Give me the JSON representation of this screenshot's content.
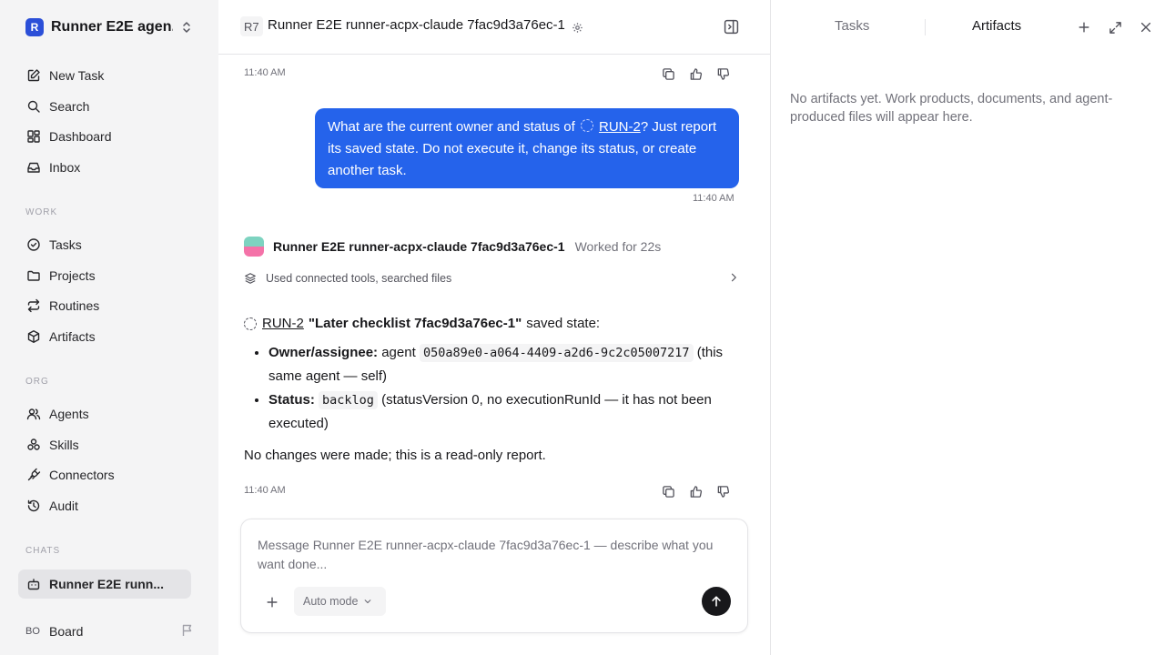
{
  "sidebar": {
    "workspace_initial": "R",
    "workspace_name": "Runner E2E agen...",
    "items_top": [
      {
        "label": "New Task",
        "icon": "edit-icon"
      },
      {
        "label": "Search",
        "icon": "search-icon"
      },
      {
        "label": "Dashboard",
        "icon": "dashboard-icon"
      },
      {
        "label": "Inbox",
        "icon": "inbox-icon"
      }
    ],
    "section_work": "WORK",
    "items_work": [
      {
        "label": "Tasks",
        "icon": "check-circle-icon"
      },
      {
        "label": "Projects",
        "icon": "folder-icon"
      },
      {
        "label": "Routines",
        "icon": "repeat-icon"
      },
      {
        "label": "Artifacts",
        "icon": "box-icon"
      }
    ],
    "section_org": "ORG",
    "items_org": [
      {
        "label": "Agents",
        "icon": "users-icon"
      },
      {
        "label": "Skills",
        "icon": "skills-icon"
      },
      {
        "label": "Connectors",
        "icon": "plug-icon"
      },
      {
        "label": "Audit",
        "icon": "history-icon"
      }
    ],
    "section_chats": "CHATS",
    "chat_active": "Runner E2E runn...",
    "board_avatar": "BO",
    "board_label": "Board"
  },
  "header": {
    "badge": "R7",
    "title": "Runner E2E runner-acpx-claude 7fac9d3a76ec-1"
  },
  "messages": {
    "time_top": "11:40 AM",
    "user_text_1": "What are the current owner and status of ",
    "user_run": "RUN-2",
    "user_text_2": "? Just report its saved state. Do not execute it, change its status, or create another task.",
    "user_time": "11:40 AM",
    "agent_name": "Runner E2E runner-acpx-claude 7fac9d3a76ec-1",
    "agent_worked": "Worked for 22s",
    "tools_summary": "Used connected tools, searched files",
    "resp_run": "RUN-2",
    "resp_title": "\"Later checklist 7fac9d3a76ec-1\"",
    "resp_suffix": "saved state:",
    "owner_label": "Owner/assignee:",
    "owner_text": "agent",
    "owner_id": "050a89e0-a064-4409-a2d6-9c2c05007217",
    "owner_note": "(this same agent — self)",
    "status_label": "Status:",
    "status_value": "backlog",
    "status_note": "(statusVersion 0, no executionRunId — it has not been executed)",
    "final_text": "No changes were made; this is a read-only report.",
    "agent_time": "11:40 AM"
  },
  "composer": {
    "placeholder": "Message Runner E2E runner-acpx-claude 7fac9d3a76ec-1 — describe what you want done...",
    "mode_label": "Auto mode"
  },
  "right_panel": {
    "tab_tasks": "Tasks",
    "tab_artifacts": "Artifacts",
    "empty_message": "No artifacts yet. Work products, documents, and agent-produced files will appear here."
  },
  "colors": {
    "accent": "#2563eb",
    "sidebar_bg": "#f4f4f5",
    "send_button": "#18181b"
  }
}
